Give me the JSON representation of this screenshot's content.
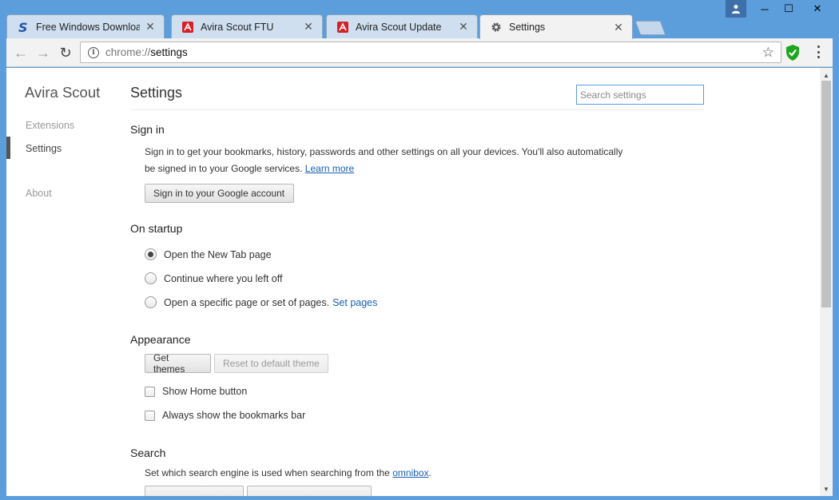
{
  "window": {
    "minimize": "─",
    "maximize": "☐",
    "close": "✕"
  },
  "tabs": [
    {
      "title": "Free Windows Download",
      "icon": "softpedia-s-icon",
      "close": "✕"
    },
    {
      "title": "Avira Scout FTU",
      "icon": "avira-icon",
      "close": "✕"
    },
    {
      "title": "Avira Scout Update",
      "icon": "avira-icon",
      "close": "✕"
    },
    {
      "title": "Settings",
      "icon": "gear-icon",
      "close": "✕"
    }
  ],
  "toolbar": {
    "back": "←",
    "forward": "→",
    "reload": "↻",
    "url_scheme": "chrome://",
    "url_path": "settings",
    "star": "☆"
  },
  "sidebar": {
    "brand": "Avira Scout",
    "items": [
      {
        "label": "Extensions"
      },
      {
        "label": "Settings"
      },
      {
        "label": "About"
      }
    ]
  },
  "settings": {
    "title": "Settings",
    "search_placeholder": "Search settings",
    "sign_in": {
      "heading": "Sign in",
      "text_1": "Sign in to get your bookmarks, history, passwords and other settings on all your devices. You'll also automatically",
      "text_2": "be signed in to your Google services.",
      "learn_more": "Learn more",
      "button": "Sign in to your Google account"
    },
    "startup": {
      "heading": "On startup",
      "options": [
        {
          "label": "Open the New Tab page"
        },
        {
          "label": "Continue where you left off"
        },
        {
          "label": "Open a specific page or set of pages."
        }
      ],
      "set_pages": "Set pages"
    },
    "appearance": {
      "heading": "Appearance",
      "get_themes": "Get themes",
      "reset_theme": "Reset to default theme",
      "show_home": "Show Home button",
      "show_bookmarks": "Always show the bookmarks bar"
    },
    "search": {
      "heading": "Search",
      "text": "Set which search engine is used when searching from the",
      "omnibox": "omnibox",
      "period": "."
    }
  },
  "scrollbar": {
    "up": "▲",
    "down": "▼"
  }
}
